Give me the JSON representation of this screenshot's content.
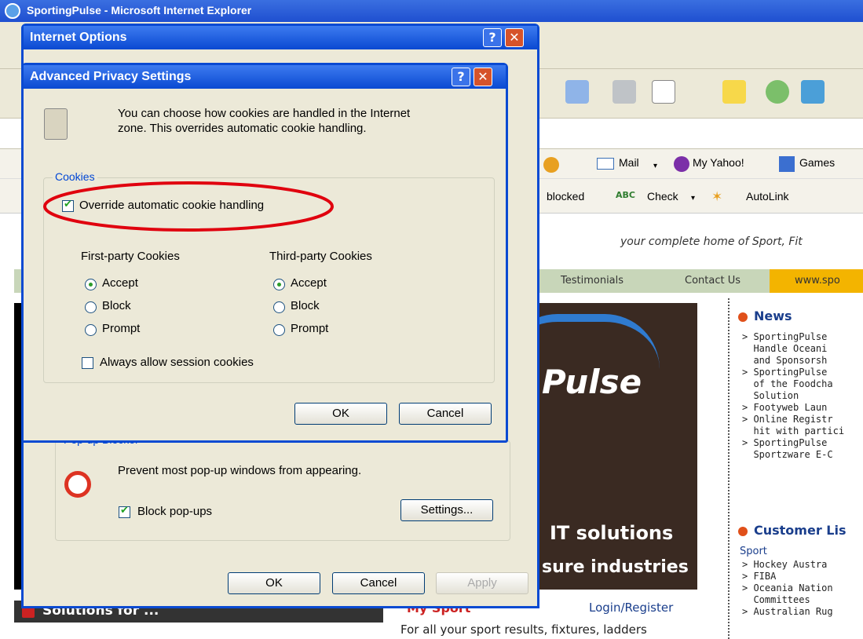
{
  "browser": {
    "title": "SportingPulse - Microsoft Internet Explorer",
    "toolbar_labels": {
      "mail": "Mail",
      "my_yahoo": "My Yahoo!",
      "games": "Games",
      "blocked": "blocked",
      "check": "Check",
      "autolink": "AutoLink",
      "partial_d": "d"
    }
  },
  "page": {
    "tagline": "your complete home of Sport, Fit",
    "nav": [
      "Testimonials",
      "Contact Us",
      "www.spo"
    ],
    "banner_text": "Pulse",
    "it_solutions": "IT solutions",
    "sure_industries": "sure industries",
    "news_heading": "News",
    "news_items": [
      "> SportingPulse",
      "  Handle Oceani",
      "  and Sponsorsh",
      "> SportingPulse",
      "  of the Foodcha",
      "  Solution",
      "> Footyweb Laun",
      "> Online Registr",
      "  hit with partici",
      "> SportingPulse",
      "  Sportzware E-C"
    ],
    "customer_heading": "Customer Lis",
    "sport_label": "Sport",
    "customer_items": [
      "> Hockey Austra",
      "> FIBA",
      "> Oceania Nation",
      "  Committees",
      "> Australian Rug"
    ],
    "solutions_for": "Solutions for ...",
    "my_sport": "My Sport",
    "login_register": "Login/Register",
    "for_all": "For all your sport results, fixtures, ladders"
  },
  "internet_options": {
    "title": "Internet Options",
    "popup_group_title": "Pop-up Blocker",
    "popup_desc": "Prevent most pop-up windows from appearing.",
    "block_popups_label": "Block pop-ups",
    "block_popups_checked": true,
    "settings_button": "Settings...",
    "ok_button": "OK",
    "cancel_button": "Cancel",
    "apply_button": "Apply"
  },
  "advanced_privacy": {
    "title": "Advanced Privacy Settings",
    "description_line1": "You can choose how cookies are handled in the Internet",
    "description_line2": "zone.  This overrides automatic cookie handling.",
    "cookies_group_title": "Cookies",
    "override_label": "Override automatic cookie handling",
    "override_checked": true,
    "first_party_heading": "First-party Cookies",
    "third_party_heading": "Third-party Cookies",
    "first_party_options": [
      "Accept",
      "Block",
      "Prompt"
    ],
    "first_party_selected": "Accept",
    "third_party_options": [
      "Accept",
      "Block",
      "Prompt"
    ],
    "third_party_selected": "Accept",
    "session_label": "Always allow session cookies",
    "session_checked": false,
    "ok_button": "OK",
    "cancel_button": "Cancel"
  },
  "colors": {
    "xp_title_blue": "#0a49d2",
    "dialog_face": "#ece9d8",
    "annotation_red": "#e0000e",
    "group_title_blue": "#0046d5"
  }
}
